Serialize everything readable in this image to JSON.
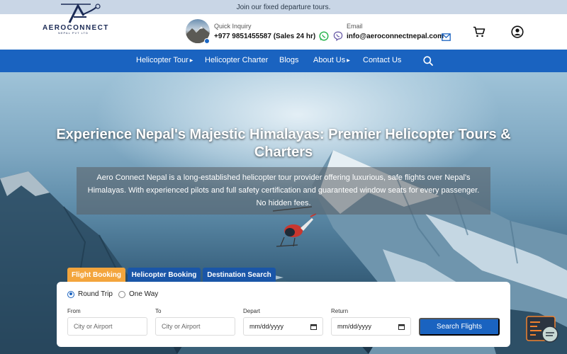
{
  "topbar": {
    "text": "Join our fixed departure tours."
  },
  "logo": {
    "name": "AEROCONNECT",
    "subtitle": "NEPAL PVT LTD"
  },
  "contact": {
    "inquiry_label": "Quick Inquiry",
    "phone": "+977 9851455587 (Sales 24 hr)",
    "email_label": "Email",
    "email": "info@aeroconnectnepal.com"
  },
  "icons": {
    "whatsapp": "whatsapp-icon",
    "viber": "viber-icon",
    "mail": "mail-icon",
    "cart": "cart-icon",
    "user": "user-icon",
    "search": "search-icon"
  },
  "nav": {
    "items": [
      {
        "label": "Helicopter Tour",
        "dropdown": true
      },
      {
        "label": "Helicopter Charter",
        "dropdown": false
      },
      {
        "label": "Blogs",
        "dropdown": false
      },
      {
        "label": "About Us",
        "dropdown": true
      },
      {
        "label": "Contact Us",
        "dropdown": false
      }
    ],
    "caret": "▶"
  },
  "hero": {
    "title": "Experience Nepal's Majestic Himalayas: Premier Helicopter Tours & Charters",
    "description": "Aero Connect Nepal is a long-established helicopter tour provider offering luxurious, safe flights over Nepal's Himalayas. With experienced pilots and full safety certification and guaranteed window seats for every passenger. No hidden fees."
  },
  "booking": {
    "tabs": [
      {
        "label": "Flight Booking",
        "active": true
      },
      {
        "label": "Helicopter Booking",
        "active": false
      },
      {
        "label": "Destination Search",
        "active": false
      }
    ],
    "trip_types": [
      {
        "label": "Round Trip",
        "selected": true
      },
      {
        "label": "One Way",
        "selected": false
      }
    ],
    "fields": {
      "from_label": "From",
      "from_placeholder": "City or Airport",
      "to_label": "To",
      "to_placeholder": "City or Airport",
      "depart_label": "Depart",
      "depart_value": "mm/dd/yyyy",
      "return_label": "Return",
      "return_value": "mm/dd/yyyy"
    },
    "submit_label": "Search Flights"
  },
  "colors": {
    "nav_blue": "#1a63c0",
    "tab_active": "#f3a53d",
    "tab_inactive": "#1a56a8",
    "chat_accent": "#f0812f"
  }
}
